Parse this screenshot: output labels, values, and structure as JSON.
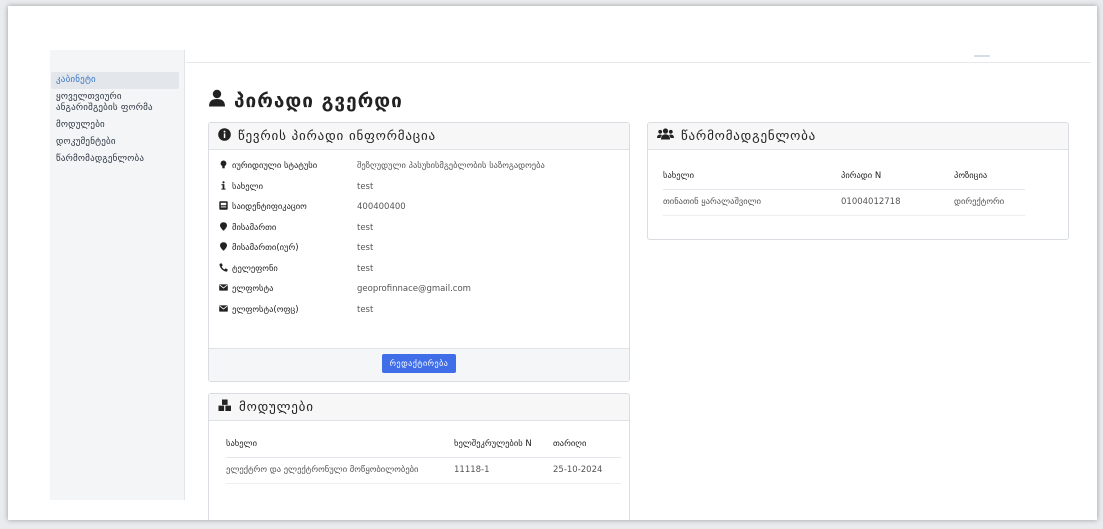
{
  "sidebar": {
    "items": [
      {
        "label": "კაბინეტი"
      },
      {
        "label": "ყოველთვიური"
      },
      {
        "label": "ანგარიშგების ფორმა"
      },
      {
        "label": "მოდულები"
      },
      {
        "label": "დოკუმენტები"
      },
      {
        "label": "წარმომადგენლობა"
      }
    ]
  },
  "page": {
    "title": "პირადი გვერდი"
  },
  "info_card": {
    "title": "წევრის პირადი ინფორმაცია",
    "rows": [
      {
        "icon": "lightbulb-icon",
        "label": "იურიდიული სტატუსი",
        "value": "შეზღუდული პასუხისმგებლობის საზოგადოება"
      },
      {
        "icon": "info-icon",
        "label": "სახელი",
        "value": "test"
      },
      {
        "icon": "id-card-icon",
        "label": "საიდენტიფიკაციო",
        "value": "400400400"
      },
      {
        "icon": "map-marker-icon",
        "label": "მისამართი",
        "value": "test"
      },
      {
        "icon": "map-marker-icon",
        "label": "მისამართი(იურ)",
        "value": "test"
      },
      {
        "icon": "phone-icon",
        "label": "ტელეფონი",
        "value": "test"
      },
      {
        "icon": "envelope-icon",
        "label": "ელფოსტა",
        "value": "geoprofinnace@gmail.com"
      },
      {
        "icon": "envelope-icon",
        "label": "ელფოსტა(ოფც)",
        "value": "test"
      }
    ],
    "edit_button": "რედაქტირება"
  },
  "modules_card": {
    "title": "მოდულები",
    "columns": [
      "სახელი",
      "ხელშეკრულების N",
      "თარიღი"
    ],
    "rows": [
      {
        "name": "ელექტრო და ელექტრონული მოწყობილობები",
        "contract": "11118-1",
        "date": "25-10-2024"
      }
    ]
  },
  "representation_card": {
    "title": "წარმომადგენლობა",
    "columns": [
      "სახელი",
      "პირადი N",
      "პოზიცია"
    ],
    "rows": [
      {
        "name": "თინათინ ყარალაშვილი",
        "personal_id": "01004012718",
        "position": "დირექტორი"
      }
    ]
  },
  "colors": {
    "accent": "#3f6ee8",
    "active_nav": "#3a76c4",
    "sidebar_bg": "#f4f5f7"
  }
}
